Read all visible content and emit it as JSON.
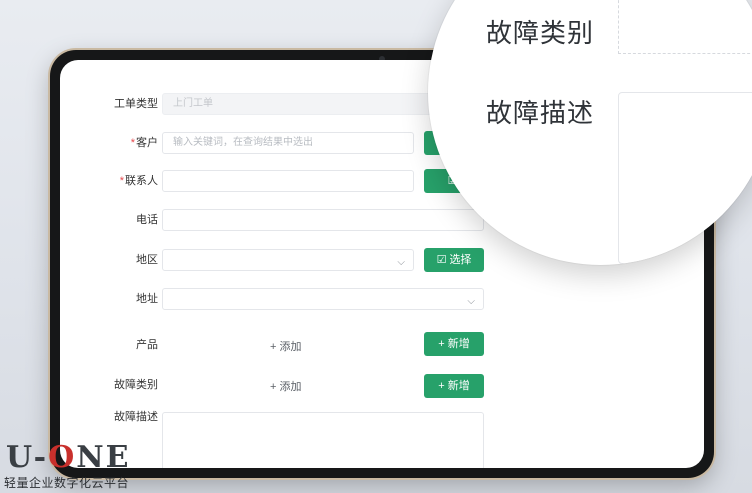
{
  "form": {
    "order_type": {
      "label": "工单类型",
      "value": "上门工单"
    },
    "customer": {
      "label": "客户",
      "required_mark": "*",
      "placeholder": "输入关键词，在查询结果中选出"
    },
    "contact": {
      "label": "联系人",
      "required_mark": "*"
    },
    "phone": {
      "label": "电话"
    },
    "region": {
      "label": "地区",
      "select_button": "选择"
    },
    "address": {
      "label": "地址"
    },
    "product": {
      "label": "产品",
      "add_link": "+ 添加",
      "new_button": "+ 新增"
    },
    "fault_category": {
      "label": "故障类别",
      "add_link": "+ 添加",
      "new_button": "+ 新增"
    },
    "fault_description": {
      "label": "故障描述"
    }
  },
  "magnifier": {
    "label_1": "故障类别",
    "label_2": "故障描述"
  },
  "logo": {
    "brand_prefix": "U-",
    "brand_o": "O",
    "brand_suffix": "NE",
    "tagline": "轻量企业数字化云平台"
  },
  "icons": {
    "chevron": "chevron-down-icon",
    "select": "check-square-icon"
  },
  "colors": {
    "accent_green": "#27a16a",
    "required_red": "#e5484d",
    "tablet_bezel": "#161718"
  }
}
